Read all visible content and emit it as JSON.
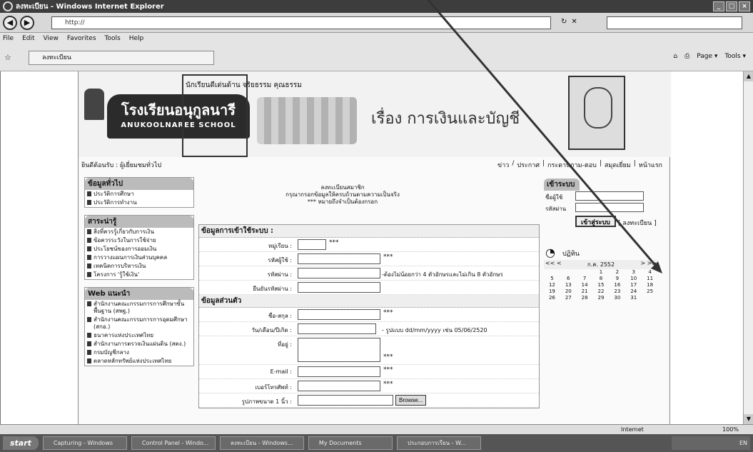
{
  "window": {
    "title": "ลงทะเบียน - Windows Internet Explorer",
    "url": "http://",
    "tab_label": "ลงทะเบียน",
    "search_placeholder": ""
  },
  "menu": [
    "File",
    "Edit",
    "View",
    "Favorites",
    "Tools",
    "Help"
  ],
  "command_bar": [
    "Page ▾",
    "Tools ▾"
  ],
  "banner": {
    "motto": "นักเรียนดีเด่นด้าน จริยธรรม คุณธรรม",
    "school_th": "โรงเรียนอนุกูลนารี",
    "school_en": "ANUKOOLNAREE SCHOOL",
    "title": "เรื่อง การเงินและบัญชี"
  },
  "breadcrumb": "ยินดีต้อนรับ : ผู้เยี่ยมชมทั่วไป",
  "topnav": [
    "ข่าว",
    "ประกาศ",
    "กระดานถาม-ตอบ",
    "สมุดเยี่ยม",
    "หน้าแรก"
  ],
  "sidebar": [
    {
      "heading": "ข้อมูลทั่วไป",
      "items": [
        "ประวัติการศึกษา",
        "ประวัติการทำงาน"
      ]
    },
    {
      "heading": "สาระน่ารู้",
      "items": [
        "สิ่งที่ควรรู้เกี่ยวกับการเงิน",
        "ข้อควรระวังในการใช้จ่าย",
        "ประโยชน์ของการออมเงิน",
        "การวางแผนการเงินส่วนบุคคล",
        "เทคนิคการบริหารเงิน",
        "โครงการ 'รู้ใช้เงิน'"
      ]
    },
    {
      "heading": "Web แนะนำ",
      "items": [
        "สำนักงานคณะกรรมการการศึกษาขั้นพื้นฐาน (สพฐ.)",
        "สำนักงานคณะกรรมการการอุดมศึกษา (สกอ.)",
        "ธนาคารแห่งประเทศไทย",
        "สำนักงานการตรวจเงินแผ่นดิน (สตง.)",
        "กรมบัญชีกลาง",
        "ตลาดหลักทรัพย์แห่งประเทศไทย"
      ]
    }
  ],
  "form": {
    "header_lines": [
      "ลงทะเบียนสมาชิก",
      "กรุณากรอกข้อมูลให้ครบถ้วนตามความเป็นจริง",
      "*** หมายถึงจำเป็นต้องกรอก"
    ],
    "section_account": "ข้อมูลการเข้าใช้ระบบ :",
    "label_member_type": "หมู่เรียน :",
    "label_user_id": "รหัสผู้ใช้ :",
    "label_password": "รหัสผ่าน :",
    "password_hint": "-ต้องไม่น้อยกว่า 4 ตัวอักษรและไม่เกิน 8 ตัวอักษร",
    "label_confirm": "ยืนยันรหัสผ่าน :",
    "section_personal": "ข้อมูลส่วนตัว",
    "label_name": "ชื่อ-สกุล :",
    "label_birth": "วัน/เดือน/ปีเกิด :",
    "birth_hint": "- รูปแบบ dd/mm/yyyy เช่น 05/06/2520",
    "label_address": "ที่อยู่ :",
    "label_email": "E-mail :",
    "label_phone": "เบอร์โทรศัพท์ :",
    "label_photo": "รูปภาพขนาด 1 นิ้ว :",
    "browse_label": "Browse...",
    "required_mark": "***"
  },
  "login": {
    "heading": "เข้าระบบ",
    "username_label": "ชื่อผู้ใช้",
    "password_label": "รหัสผ่าน",
    "submit_label": "เข้าสู่ระบบ",
    "register_label": "[ ลงทะเบียน ]"
  },
  "calendar": {
    "title": "ปฏิทิน",
    "month": "ก.ค. 2552",
    "prev": "<< <",
    "next": "> >>",
    "days": [
      "",
      "",
      "",
      "1",
      "2",
      "3",
      "4",
      "5",
      "6",
      "7",
      "8",
      "9",
      "10",
      "11",
      "12",
      "13",
      "14",
      "15",
      "16",
      "17",
      "18",
      "19",
      "20",
      "21",
      "22",
      "23",
      "24",
      "25",
      "26",
      "27",
      "28",
      "29",
      "30",
      "31",
      ""
    ]
  },
  "status": {
    "zone": "Internet",
    "zoom": "100%"
  },
  "taskbar": {
    "start": "start",
    "items": [
      "Capturing - Windows",
      "Control Panel - Windo...",
      "ลงทะเบียน - Windows...",
      "My Documents",
      "ประกอบการเรียน - W..."
    ],
    "tray": "EN"
  }
}
